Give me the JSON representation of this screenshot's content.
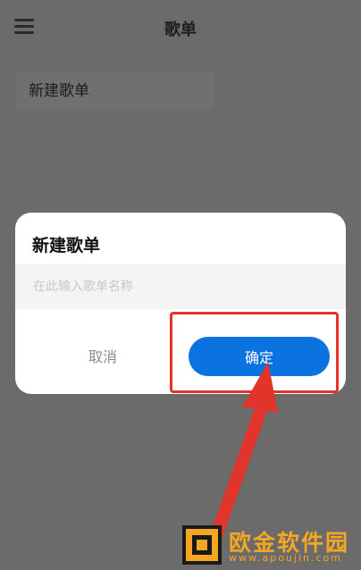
{
  "header": {
    "title": "歌单",
    "menu_icon": "hamburger-menu-icon"
  },
  "list": {
    "new_playlist_label": "新建歌单"
  },
  "dialog": {
    "title": "新建歌单",
    "input_placeholder": "在此输入歌单名称",
    "input_value": "",
    "cancel_label": "取消",
    "confirm_label": "确定"
  },
  "annotation": {
    "color": "#e1342a"
  },
  "watermark": {
    "name": "欧金软件园",
    "url": "www.apoujin.com",
    "color": "#f5a623"
  },
  "colors": {
    "accent": "#0b73df",
    "overlay": "#6b6b6b"
  }
}
